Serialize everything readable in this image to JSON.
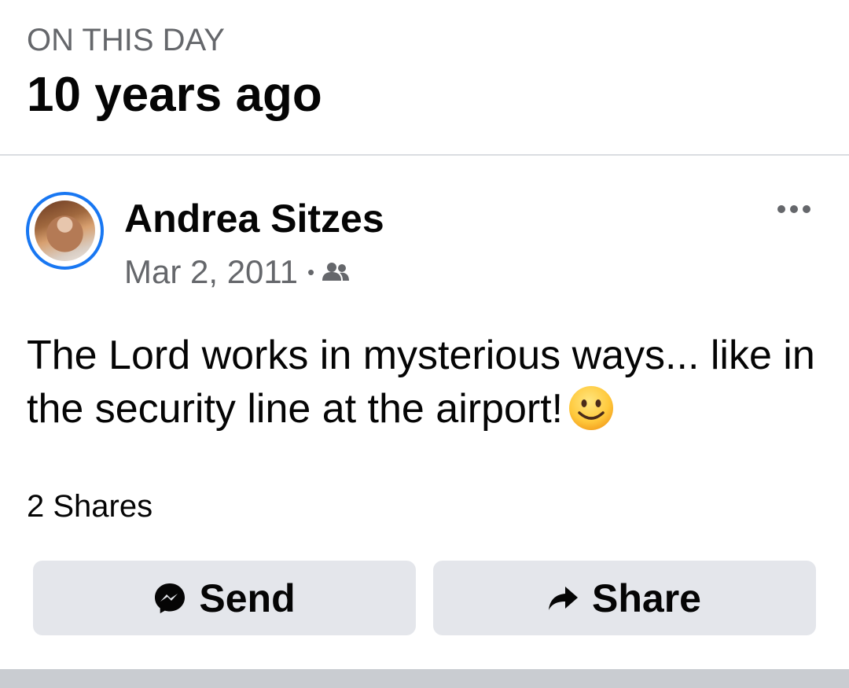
{
  "memory": {
    "eyebrow": "ON THIS DAY",
    "headline": "10 years ago"
  },
  "post": {
    "author": "Andrea Sitzes",
    "date": "Mar 2, 2011",
    "separator": "•",
    "audience_icon": "friends-icon",
    "text": "The Lord works in mysterious ways... like in the security line at the airport!",
    "emoji": "slightly-smiling-face",
    "shares": "2 Shares"
  },
  "actions": {
    "send_label": "Send",
    "share_label": "Share"
  },
  "colors": {
    "accent": "#1877f2",
    "secondary_text": "#65676b",
    "button_bg": "#e4e6eb",
    "divider": "#dadde1"
  }
}
